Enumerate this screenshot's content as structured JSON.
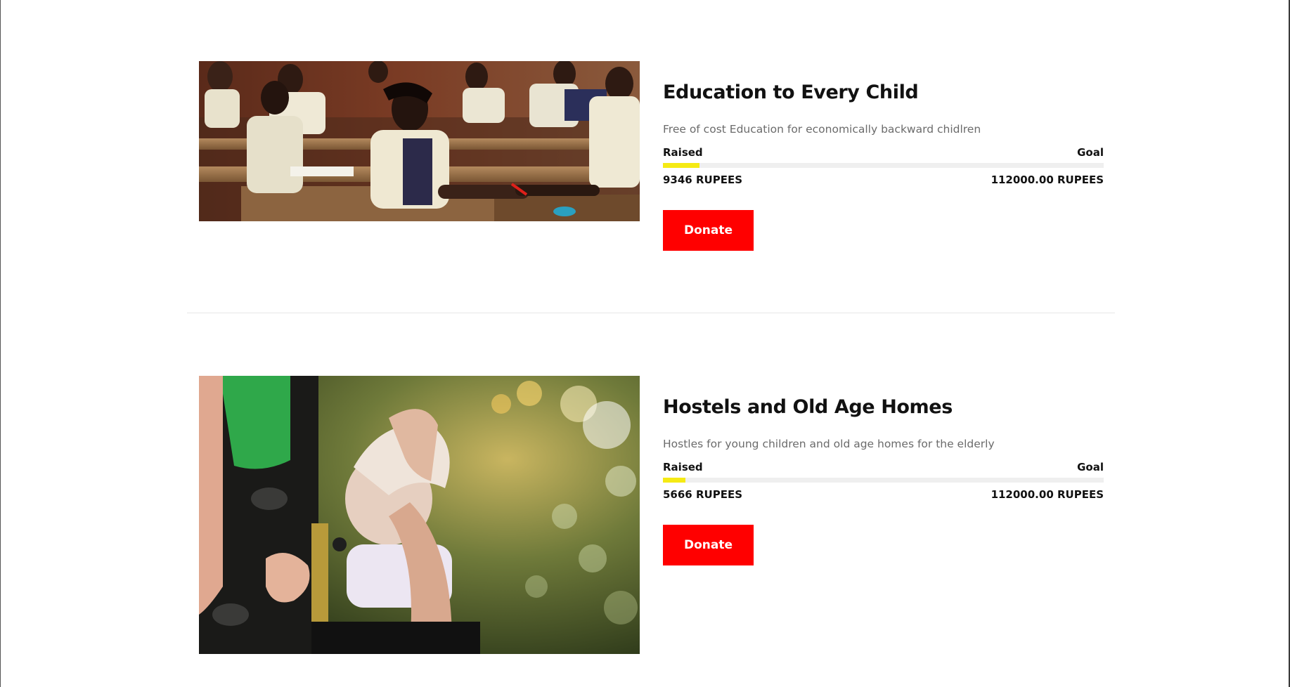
{
  "colors": {
    "accent": "#ff0000",
    "progress_fill": "#f5ea14",
    "progress_track": "#efefef",
    "description_text": "#6b6b6b"
  },
  "causes": [
    {
      "title": "Education to Every Child",
      "description": "Free of cost Education for economically backward chidlren",
      "raised_label": "Raised",
      "goal_label": "Goal",
      "raised_amount": "9346 RUPEES",
      "goal_amount": "112000.00 RUPEES",
      "progress_fraction": 0.083,
      "donate_label": "Donate",
      "image_subject": "classroom-students-photo"
    },
    {
      "title": "Hostels and Old Age Homes",
      "description": "Hostles for young children and old age homes for the elderly",
      "raised_label": "Raised",
      "goal_label": "Goal",
      "raised_amount": "5666 RUPEES",
      "goal_amount": "112000.00 RUPEES",
      "progress_fraction": 0.051,
      "donate_label": "Donate",
      "image_subject": "elderly-man-wheelchair-photo"
    }
  ]
}
